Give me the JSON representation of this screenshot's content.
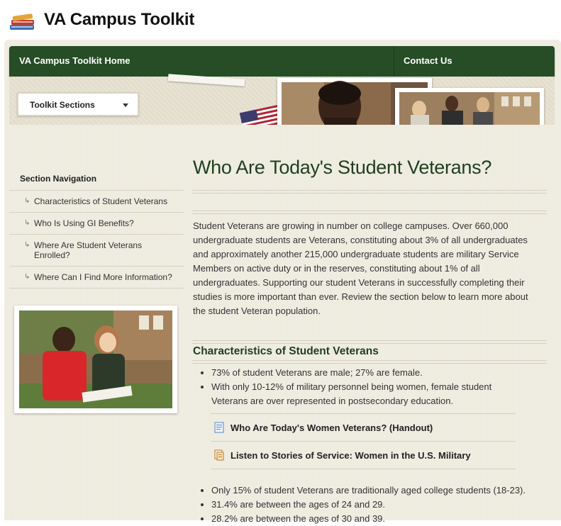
{
  "header": {
    "title": "VA Campus Toolkit",
    "logo_icon": "books-icon"
  },
  "nav": {
    "home_label": "VA Campus Toolkit Home",
    "contact_label": "Contact Us",
    "bg_color": "#264d25"
  },
  "banner": {
    "toolkit_sections_label": "Toolkit Sections"
  },
  "sidebar": {
    "title": "Section Navigation",
    "items": [
      {
        "label": "Characteristics of Student Veterans"
      },
      {
        "label": "Who Is Using GI Benefits?"
      },
      {
        "label": "Where Are Student Veterans Enrolled?"
      },
      {
        "label": "Where Can I Find More Information?"
      }
    ]
  },
  "main": {
    "title": "Who Are Today's Student Veterans?",
    "intro": "Student Veterans are growing in number on college campuses. Over 660,000 undergraduate students are Veterans, constituting about 3% of all undergraduates and approximately another 215,000 undergraduate students are military Service Members on active duty or in the reserves, constituting about 1% of all undergraduates. Supporting our student Veterans in successfully completing their studies is more important than ever. Review the section below to learn more about the student Veteran population.",
    "section_title": "Characteristics of Student Veterans",
    "facts_a": [
      "73% of student Veterans are male; 27% are female.",
      "With only 10-12% of military personnel being women, female student Veterans are over represented in postsecondary education."
    ],
    "resources": [
      {
        "label": "Who Are Today's Women Veterans? (Handout)",
        "icon": "document-icon"
      },
      {
        "label": "Listen to Stories of Service: Women in the U.S. Military",
        "icon": "audio-transcript-icon"
      }
    ],
    "facts_b": [
      "Only 15% of student Veterans are traditionally aged college students (18-23).",
      "31.4% are between the ages of 24 and 29.",
      "28.2% are between the ages of 30 and 39."
    ]
  },
  "colors": {
    "heading_green": "#1f3f1f",
    "page_bg": "#eeebdf"
  }
}
